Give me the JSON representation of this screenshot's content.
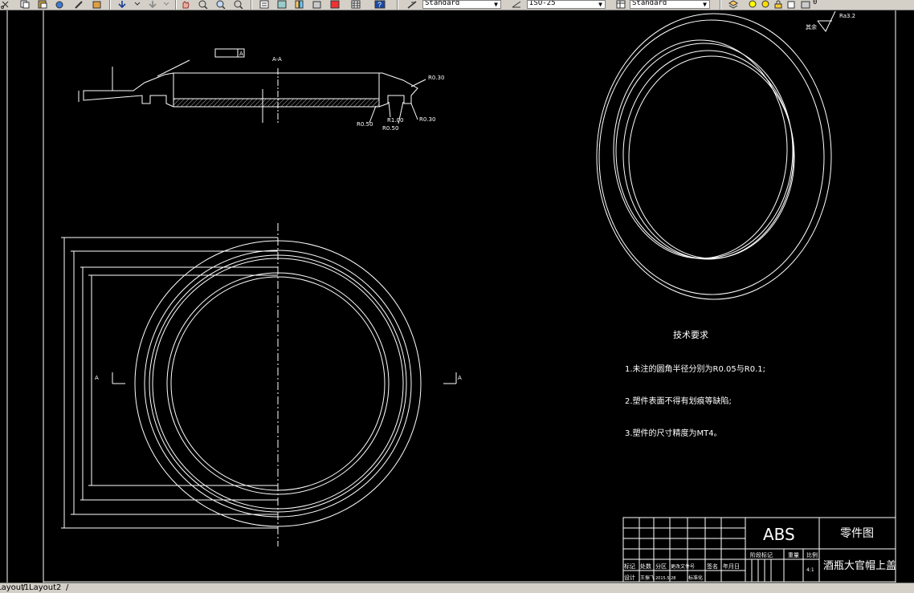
{
  "toolbar": {
    "text_style": "Standard",
    "dim_style": "ISO-25",
    "table_style": "Standard",
    "layer": "0"
  },
  "drawing": {
    "section_view": {
      "section_label": "A-A",
      "radius_labels": [
        "R0.30",
        "R0.50",
        "R1.00",
        "R0.50",
        "R0.30"
      ],
      "gtol_datum": "A"
    },
    "plan_view": {
      "section_marks": [
        "A",
        "A"
      ]
    },
    "roughness": {
      "symbol_value": "Ra3.2",
      "note": "其余"
    },
    "technical_requirements": {
      "title": "技术要求",
      "items": [
        "1.未注的圆角半径分别为R0.05与R0.1;",
        "2.塑件表面不得有划痕等缺陷;",
        "3.塑件的尺寸精度为MT4。"
      ]
    },
    "title_block": {
      "material": "ABS",
      "drawing_type": "零件图",
      "part_name": "酒瓶大官帽上盖",
      "headers": [
        "标记",
        "处数",
        "分区",
        "更改文件号",
        "签名",
        "年月日"
      ],
      "row2": [
        "设计",
        "王振飞",
        "2015.5.28",
        "标准化"
      ],
      "stage_headers": [
        "阶段标记",
        "重量",
        "比例"
      ],
      "scale": "4:1"
    }
  },
  "layout_tabs": [
    "Layout1",
    "Layout2"
  ]
}
